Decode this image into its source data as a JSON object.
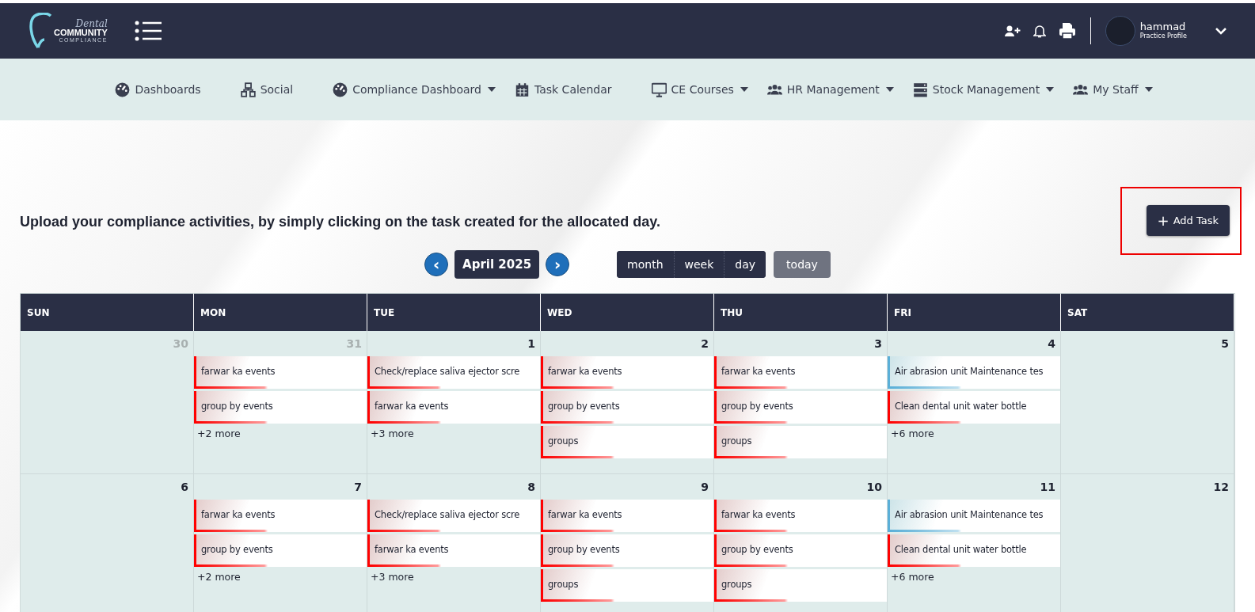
{
  "header": {
    "logo": {
      "script": "Dental",
      "main": "COMMUNITY",
      "sub": "COMPLIANCE"
    },
    "user": {
      "name": "hammad",
      "role": "Practice Profile"
    }
  },
  "nav": [
    {
      "label": "Dashboards",
      "dropdown": false
    },
    {
      "label": "Social",
      "dropdown": false
    },
    {
      "label": "Compliance Dashboard",
      "dropdown": true
    },
    {
      "label": "Task Calendar",
      "dropdown": false
    },
    {
      "label": "CE Courses",
      "dropdown": true
    },
    {
      "label": "HR Management",
      "dropdown": true
    },
    {
      "label": "Stock Management",
      "dropdown": true
    },
    {
      "label": "My Staff",
      "dropdown": true
    }
  ],
  "intro": "Upload your compliance activities, by simply clicking on the task created for the allocated day.",
  "add_task": {
    "icon": "+",
    "label": "Add Task",
    "highlighted": true
  },
  "toolbar": {
    "prev": "‹",
    "title": "April 2025",
    "next": "›",
    "views": [
      "month",
      "week",
      "day"
    ],
    "today": {
      "label": "today",
      "disabled": true
    }
  },
  "calendar": {
    "columns": [
      "SUN",
      "MON",
      "TUE",
      "WED",
      "THU",
      "FRI",
      "SAT"
    ],
    "weeks": [
      {
        "days": [
          {
            "date": "30",
            "muted": true
          },
          {
            "date": "31",
            "muted": true,
            "events": [
              {
                "title": "farwar ka events",
                "color": "#ff0000"
              },
              {
                "title": "group by events",
                "color": "#ff0000"
              }
            ],
            "more": "+2 more"
          },
          {
            "date": "1",
            "muted": false,
            "events": [
              {
                "title": "Check/replace saliva ejector scre",
                "color": "#ff0000"
              },
              {
                "title": "farwar ka events",
                "color": "#ff0000"
              }
            ],
            "more": "+3 more"
          },
          {
            "date": "2",
            "muted": false,
            "events": [
              {
                "title": "farwar ka events",
                "color": "#ff0000"
              },
              {
                "title": "group by events",
                "color": "#ff0000"
              },
              {
                "title": "groups",
                "color": "#ff0000"
              }
            ]
          },
          {
            "date": "3",
            "muted": false,
            "events": [
              {
                "title": "farwar ka events",
                "color": "#ff0000"
              },
              {
                "title": "group by events",
                "color": "#ff0000"
              },
              {
                "title": "groups",
                "color": "#ff0000"
              }
            ]
          },
          {
            "date": "4",
            "muted": false,
            "events": [
              {
                "title": "Air abrasion unit Maintenance tes",
                "color": "#5aafd8"
              },
              {
                "title": "Clean dental unit water bottle",
                "color": "#ff0000"
              }
            ],
            "more": "+6 more"
          },
          {
            "date": "5",
            "muted": false
          }
        ]
      },
      {
        "days": [
          {
            "date": "6",
            "muted": false
          },
          {
            "date": "7",
            "muted": false,
            "events": [
              {
                "title": "farwar ka events",
                "color": "#ff0000"
              },
              {
                "title": "group by events",
                "color": "#ff0000"
              }
            ],
            "more": "+2 more"
          },
          {
            "date": "8",
            "muted": false,
            "events": [
              {
                "title": "Check/replace saliva ejector scre",
                "color": "#ff0000"
              },
              {
                "title": "farwar ka events",
                "color": "#ff0000"
              }
            ],
            "more": "+3 more"
          },
          {
            "date": "9",
            "muted": false,
            "events": [
              {
                "title": "farwar ka events",
                "color": "#ff0000"
              },
              {
                "title": "group by events",
                "color": "#ff0000"
              },
              {
                "title": "groups",
                "color": "#ff0000"
              }
            ]
          },
          {
            "date": "10",
            "muted": false,
            "events": [
              {
                "title": "farwar ka events",
                "color": "#ff0000"
              },
              {
                "title": "group by events",
                "color": "#ff0000"
              },
              {
                "title": "groups",
                "color": "#ff0000"
              }
            ]
          },
          {
            "date": "11",
            "muted": false,
            "events": [
              {
                "title": "Air abrasion unit Maintenance tes",
                "color": "#5aafd8"
              },
              {
                "title": "Clean dental unit water bottle",
                "color": "#ff0000"
              }
            ],
            "more": "+6 more"
          },
          {
            "date": "12",
            "muted": false
          }
        ]
      }
    ]
  }
}
